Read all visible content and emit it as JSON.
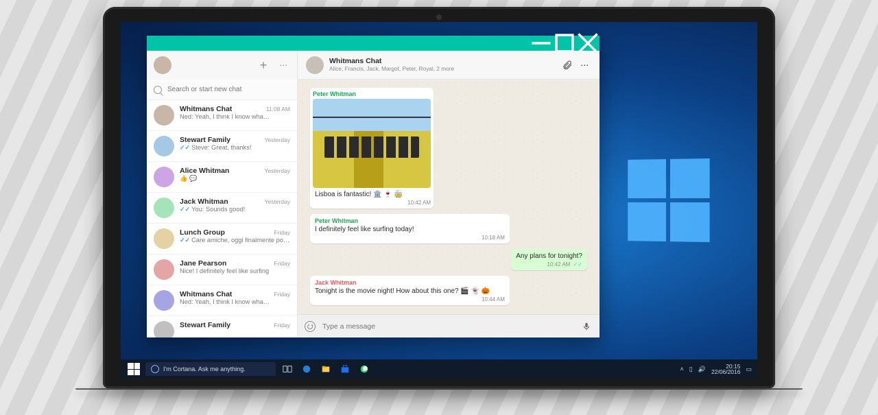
{
  "taskbar": {
    "cortana_placeholder": "I'm Cortana. Ask me anything.",
    "time": "20:15",
    "date": "22/06/2016"
  },
  "window": {
    "app_name": "WhatsApp"
  },
  "sidebar": {
    "search_placeholder": "Search or start new chat",
    "chats": [
      {
        "name": "Whitmans Chat",
        "time": "11:08 AM",
        "preview": "Ned: Yeah, I think I know wha…",
        "ticks": false
      },
      {
        "name": "Stewart Family",
        "time": "Yesterday",
        "preview": "Steve: Great, thanks!",
        "ticks": true
      },
      {
        "name": "Alice Whitman",
        "time": "Yesterday",
        "preview": "👍 💬",
        "ticks": false
      },
      {
        "name": "Jack Whitman",
        "time": "Yesterday",
        "preview": "You: Sounds good!",
        "ticks": true
      },
      {
        "name": "Lunch Group",
        "time": "Friday",
        "preview": "Care amiche, oggi finalmente posso",
        "ticks": true
      },
      {
        "name": "Jane Pearson",
        "time": "Friday",
        "preview": "Nice! I definitely feel like surfing",
        "ticks": false
      },
      {
        "name": "Whitmans Chat",
        "time": "Friday",
        "preview": "Ned: Yeah, I think I know wha…",
        "ticks": false
      },
      {
        "name": "Stewart Family",
        "time": "Friday",
        "preview": "",
        "ticks": false
      }
    ]
  },
  "conversation": {
    "title": "Whitmans Chat",
    "subtitle": "Alice, Francis, Jack, Margot, Peter, Royal, 2 more",
    "composer_placeholder": "Type a message",
    "messages": [
      {
        "kind": "in",
        "sender": "Peter Whitman",
        "sender_class": "peter",
        "is_image": true,
        "caption": "Lisboa is fantastic!  🏛️ 🍷 🚋",
        "time": "10:42 AM"
      },
      {
        "kind": "in",
        "sender": "Peter Whitman",
        "sender_class": "peter",
        "text": "I definitely feel like surfing today!",
        "time": "10:18 AM"
      },
      {
        "kind": "out",
        "text": "Any plans for tonight?",
        "time": "10:42 AM",
        "read": true
      },
      {
        "kind": "in",
        "sender": "Jack Whitman",
        "sender_class": "jack",
        "text": "Tonight is the movie night! How about this one?  🎬 👻 🎃",
        "time": "10:44 AM"
      }
    ]
  },
  "colors": {
    "accent": "#01c3a7",
    "outgoing_bubble": "#d9fdd3",
    "chat_bg": "#efeae2"
  }
}
